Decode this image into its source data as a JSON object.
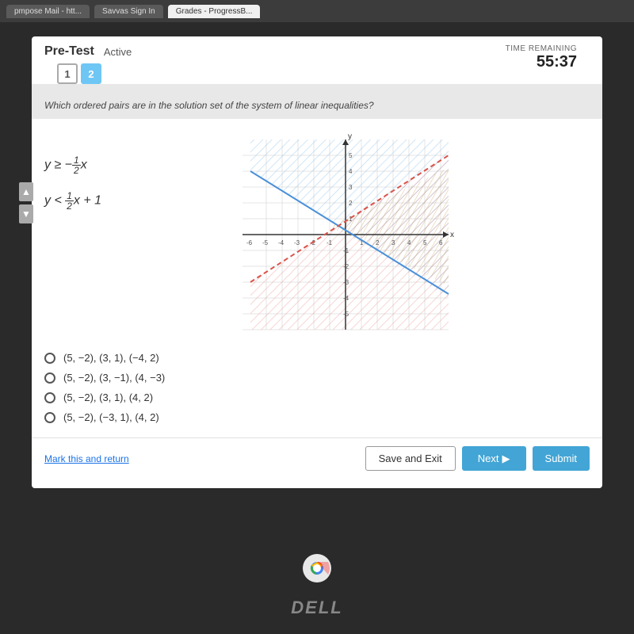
{
  "tabs": [
    {
      "label": "pmpose Mail - htt...",
      "active": false
    },
    {
      "label": "Savvas Sign In",
      "active": false
    },
    {
      "label": "Grades - ProgressB...",
      "active": true
    }
  ],
  "header": {
    "pre_test_label": "Pre-Test",
    "active_badge": "Active",
    "question_numbers": [
      "1",
      "2"
    ],
    "current_question": 2,
    "time_label": "TIME REMAINING",
    "time_value": "55:37"
  },
  "question": {
    "text": "Which ordered pairs are in the solution set of the system of linear inequalities?",
    "equations": [
      "y ≥ −½x",
      "y < ½x + 1"
    ]
  },
  "answers": [
    {
      "id": "a",
      "text": "(5, −2), (3, 1), (−4, 2)"
    },
    {
      "id": "b",
      "text": "(5, −2), (3, −1), (4, −3)"
    },
    {
      "id": "c",
      "text": "(5, −2), (3, 1), (4, 2)"
    },
    {
      "id": "d",
      "text": "(5, −2), (−3, 1), (4, 2)"
    }
  ],
  "footer": {
    "mark_return": "Mark this and return",
    "save_exit": "Save and Exit",
    "next": "Next",
    "submit": "Submit"
  },
  "icons": {
    "next_arrow": "▶",
    "nav_up": "▲",
    "nav_down": "▼"
  }
}
